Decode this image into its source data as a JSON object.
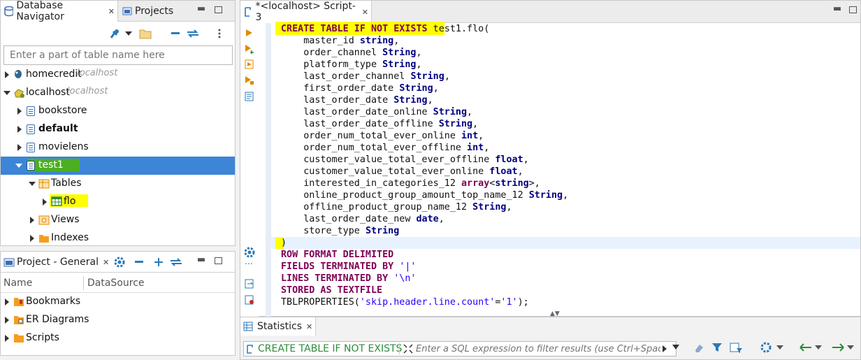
{
  "navigator": {
    "tab_label": "Database Navigator",
    "projects_tab_label": "Projects",
    "search_placeholder": "Enter a part of table name here",
    "items": [
      {
        "label": "homecredit",
        "host": "localhost"
      },
      {
        "label": "localhost",
        "host": "localhost"
      },
      {
        "label": "bookstore"
      },
      {
        "label": "default"
      },
      {
        "label": "movielens"
      },
      {
        "label": "test1"
      },
      {
        "label": "Tables"
      },
      {
        "label": "flo"
      },
      {
        "label": "Views"
      },
      {
        "label": "Indexes"
      }
    ]
  },
  "project": {
    "tab_label": "Project - General",
    "columns": [
      "Name",
      "DataSource"
    ],
    "items": [
      "Bookmarks",
      "ER Diagrams",
      "Scripts"
    ]
  },
  "editor": {
    "tab_label": "*<localhost> Script-3",
    "lines": [
      "CREATE TABLE IF NOT EXISTS test1.flo(",
      "    master_id string,",
      "    order_channel String,",
      "    platform_type String,",
      "    last_order_channel String,",
      "    first_order_date String,",
      "    last_order_date String,",
      "    last_order_date_online String,",
      "    last_order_date_offline String,",
      "    order_num_total_ever_online int,",
      "    order_num_total_ever_offline int,",
      "    customer_value_total_ever_offline float,",
      "    customer_value_total_ever_online float,",
      "    interested_in_categories_12 array<string>,",
      "    online_product_group_amount_top_name_12 String,",
      "    offline_product_group_name_12 String,",
      "    last_order_date_new date,",
      "    store_type String",
      ")",
      "ROW FORMAT DELIMITED",
      "FIELDS TERMINATED BY '|'",
      "LINES TERMINATED BY '\\n'",
      "STORED AS TEXTFILE",
      "TBLPROPERTIES('skip.header.line.count'='1');"
    ]
  },
  "statistics": {
    "tab_label": "Statistics",
    "query_label": "CREATE TABLE IF NOT EXISTS",
    "filter_placeholder": "Enter a SQL expression to filter results (use Ctrl+Space)"
  },
  "colors": {
    "selection": "#3d85d6",
    "highlight": "#ffff00",
    "accent": "#2a7ab8"
  }
}
